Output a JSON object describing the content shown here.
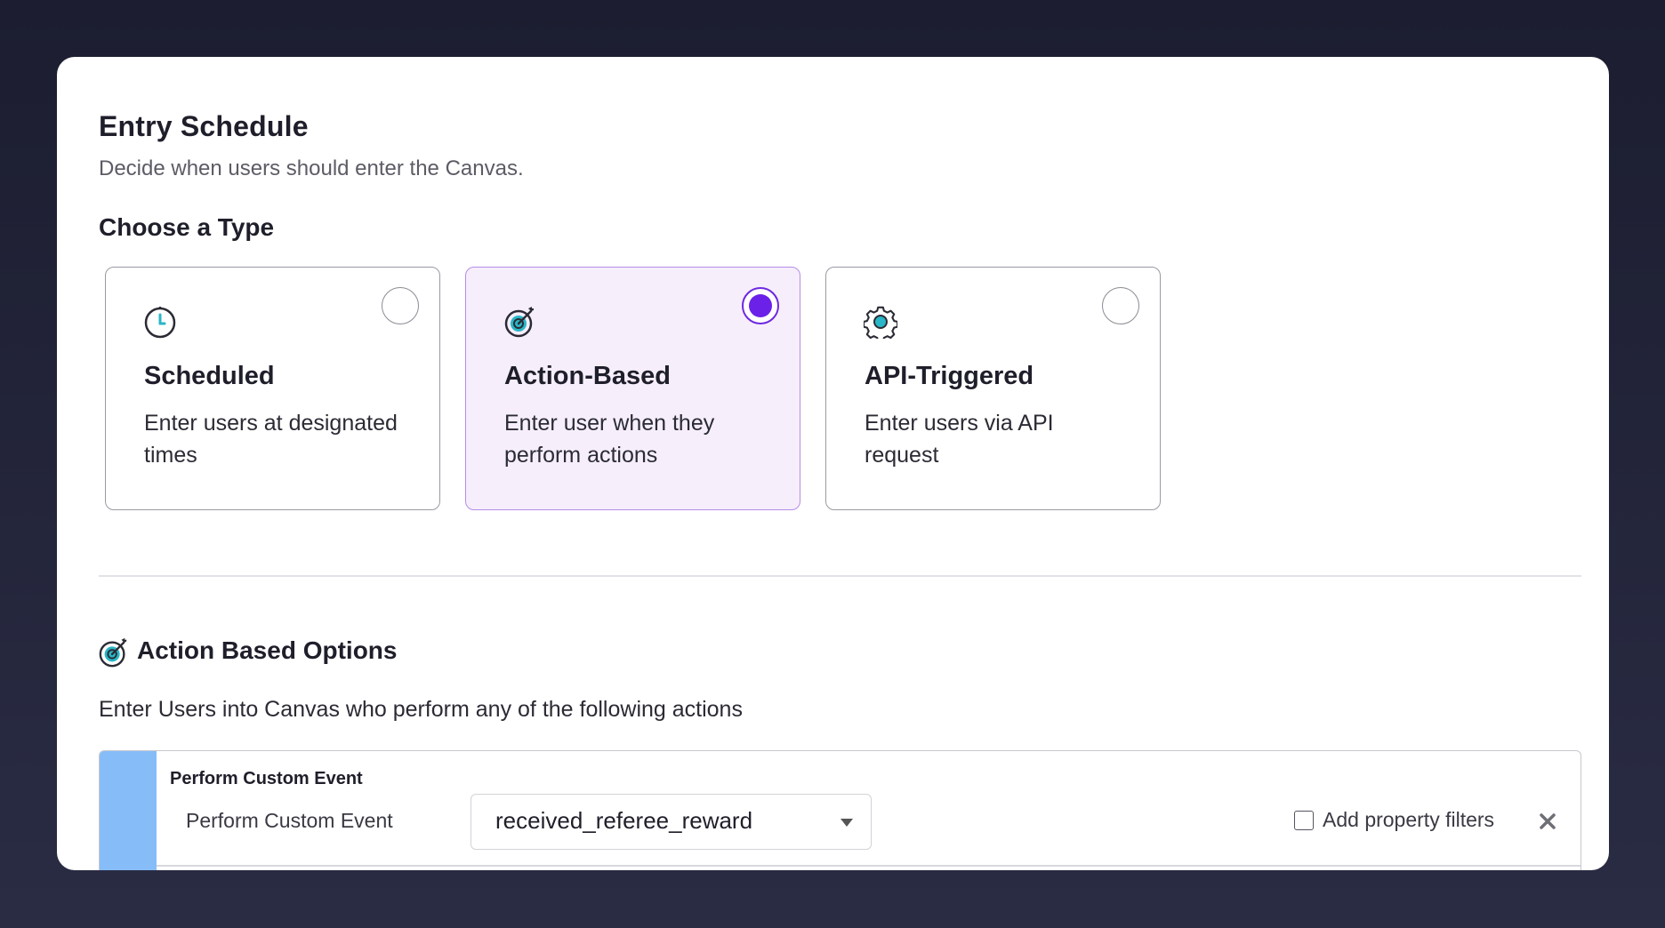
{
  "header": {
    "title": "Entry Schedule",
    "subtitle": "Decide when users should enter the Canvas."
  },
  "choose_type": {
    "heading": "Choose a Type",
    "cards": [
      {
        "icon": "clock-icon",
        "name": "Scheduled",
        "description": "Enter users at designated times",
        "selected": false
      },
      {
        "icon": "target-icon",
        "name": "Action-Based",
        "description": "Enter user when they perform actions",
        "selected": true
      },
      {
        "icon": "gear-icon",
        "name": "API-Triggered",
        "description": "Enter users via API request",
        "selected": false
      }
    ]
  },
  "action_options": {
    "icon": "target-icon",
    "title": "Action Based Options",
    "description": "Enter Users into Canvas who perform any of the following actions",
    "event": {
      "heading": "Perform Custom Event",
      "label": "Perform Custom Event",
      "selected_value": "received_referee_reward",
      "filters_label": "Add property filters",
      "filters_checked": false,
      "close_icon": "close-icon"
    }
  },
  "colors": {
    "accent": "#6b21e8",
    "selected_card_bg": "#f6eefb",
    "event_bar": "#86bdf9",
    "icon_teal": "#29b6c6"
  }
}
